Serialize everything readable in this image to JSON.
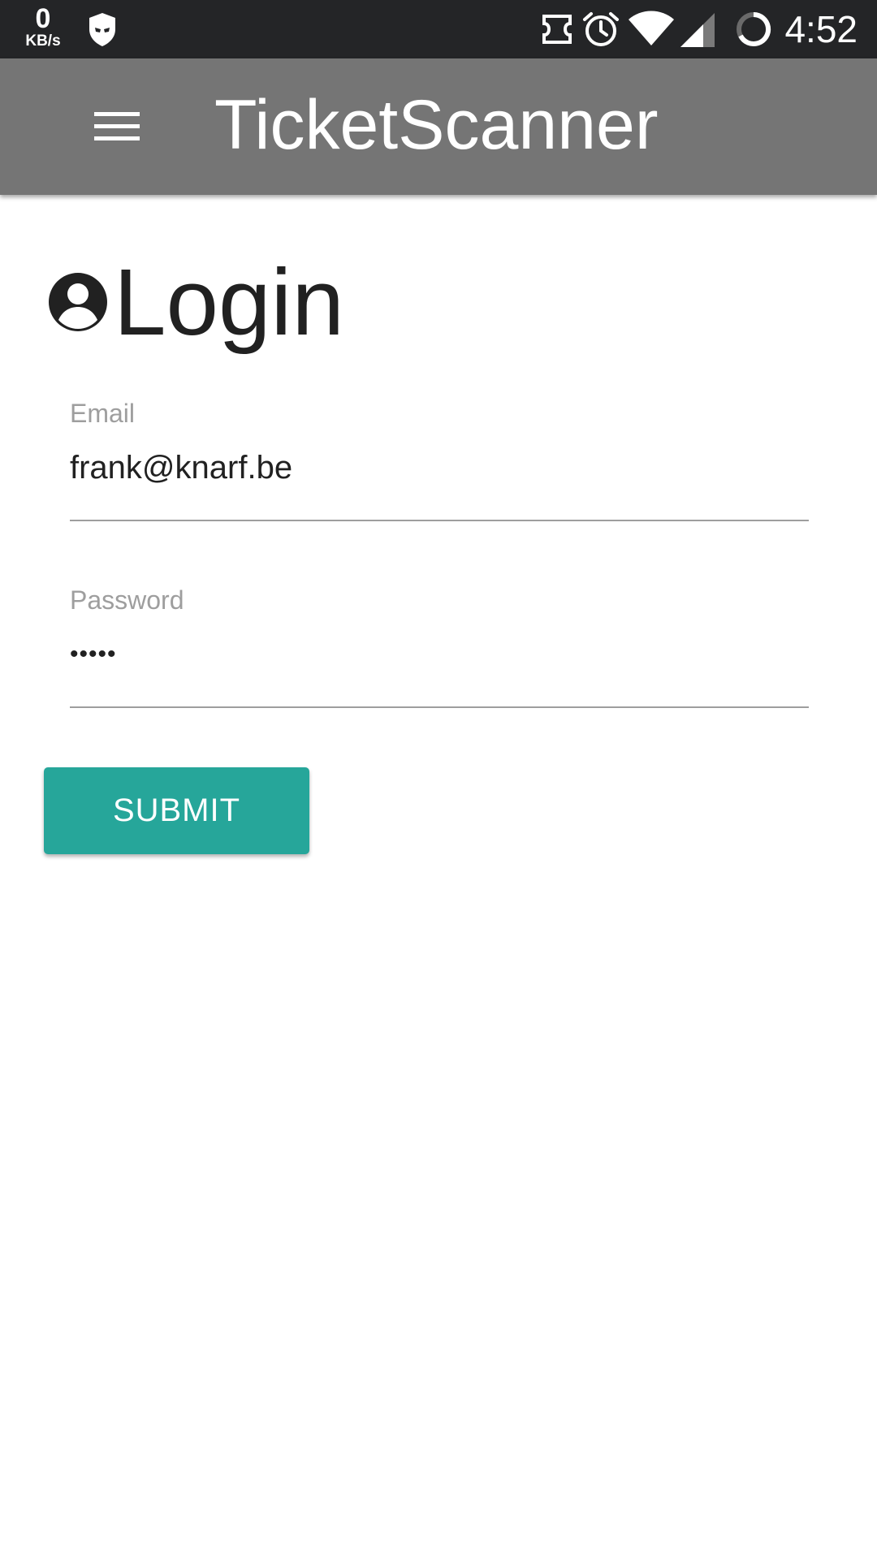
{
  "status_bar": {
    "net_speed_value": "0",
    "net_speed_unit": "KB/s",
    "time": "4:52",
    "icons": [
      "shield-icon",
      "ticket-notification-icon",
      "alarm-icon",
      "wifi-icon",
      "cell-signal-icon",
      "battery-ring-icon"
    ]
  },
  "app_bar": {
    "title": "TicketScanner",
    "menu_icon": "hamburger-menu-icon"
  },
  "login": {
    "heading": "Login",
    "heading_icon": "account-circle-icon",
    "email_label": "Email",
    "email_value": "frank@knarf.be",
    "password_label": "Password",
    "password_value": "•••••",
    "submit_label": "SUBMIT"
  },
  "colors": {
    "status_bar": "#242527",
    "app_bar": "#757575",
    "accent": "#26a69a",
    "text_primary": "#212121",
    "label": "#9e9e9e"
  }
}
